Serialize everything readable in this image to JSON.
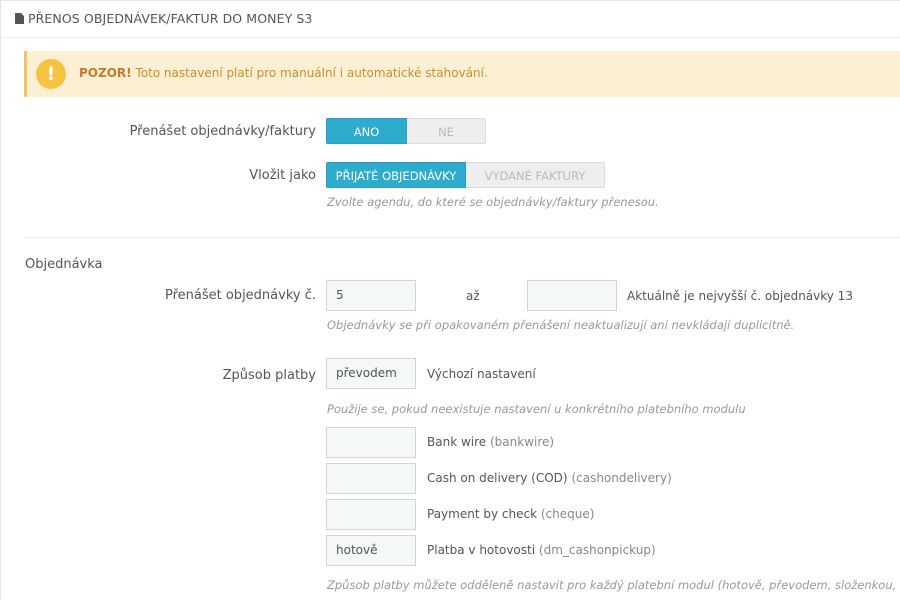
{
  "panel": {
    "title": "PŘENOS OBJEDNÁVEK/FAKTUR DO MONEY S3"
  },
  "alert": {
    "icon": "exclamation-icon",
    "strong": "POZOR!",
    "text": " Toto nastavení platí pro manuální i automatické stahování."
  },
  "transfer": {
    "label": "Přenášet objednávky/faktury",
    "yes": "ANO",
    "no": "NE",
    "selected": "ANO"
  },
  "insert_as": {
    "label": "Vložit jako",
    "option1": "PŘIJATÉ OBJEDNÁVKY",
    "option2": "VYDANÉ FAKTURY",
    "selected": "PŘIJATÉ OBJEDNÁVKY",
    "help": "Zvolte agendu, do které se objednávky/faktury přenesou."
  },
  "section_order": {
    "title": "Objednávka"
  },
  "order_range": {
    "label": "Přenášet objednávky č.",
    "from_value": "5",
    "to_label": "až",
    "to_value": "",
    "current": "Aktuálně je nejvyšší č. objednávky 13",
    "help": "Objednávky se při opakovaném přenášení neaktualizují ani nevkládají duplicitně."
  },
  "payment": {
    "label": "Způsob platby",
    "default_value": "převodem",
    "default_label": "Výchozí nastavení",
    "help": "Použije se, pokud neexistuje nastavení u konkrétního platebního modulu",
    "modules": [
      {
        "value": "",
        "name": "Bank wire",
        "code": "(bankwire)"
      },
      {
        "value": "",
        "name": "Cash on delivery (COD)",
        "code": "(cashondelivery)"
      },
      {
        "value": "",
        "name": "Payment by check",
        "code": "(cheque)"
      },
      {
        "value": "hotově",
        "name": "Platba v hotovosti",
        "code": "(dm_cashonpickup)"
      }
    ],
    "footer_help": "Způsob platby můžete odděleně nastavit pro každý platební modul (hotově, převodem, složenkou, dob"
  },
  "colors": {
    "accent": "#2eacce",
    "warning_bg": "#fcefd4",
    "warning_icon": "#f5c242"
  }
}
